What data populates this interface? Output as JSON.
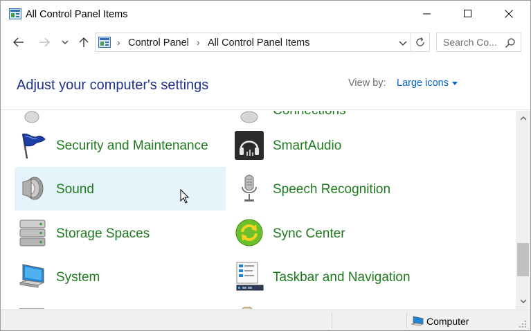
{
  "window": {
    "title": "All Control Panel Items",
    "icon": "control-panel-icon"
  },
  "titlebar_buttons": {
    "minimize_icon": "minimize-icon",
    "maximize_icon": "maximize-icon",
    "close_icon": "close-icon"
  },
  "navigation": {
    "back_icon": "arrow-left-icon",
    "forward_icon": "arrow-right-icon",
    "recent_icon": "chevron-down-icon",
    "up_icon": "arrow-up-icon",
    "breadcrumbs": [
      "Control Panel",
      "All Control Panel Items"
    ],
    "refresh_icon": "refresh-icon"
  },
  "search": {
    "placeholder": "Search Co...",
    "value": ""
  },
  "header": {
    "title": "Adjust your computer's settings",
    "view_by_label": "View by:",
    "view_by_value": "Large icons"
  },
  "items": {
    "partial_top_right": "Connections",
    "security": "Security and Maintenance",
    "smartaudio": "SmartAudio",
    "sound": "Sound",
    "speech": "Speech Recognition",
    "storage": "Storage Spaces",
    "sync": "Sync Center",
    "system": "System",
    "taskbar": "Taskbar and Navigation"
  },
  "colors": {
    "item_link": "#1e7a1e",
    "title": "#1e3287",
    "link_blue": "#0066cc",
    "hover_bg": "#e5f3fb"
  },
  "statusbar": {
    "location": "Computer"
  }
}
